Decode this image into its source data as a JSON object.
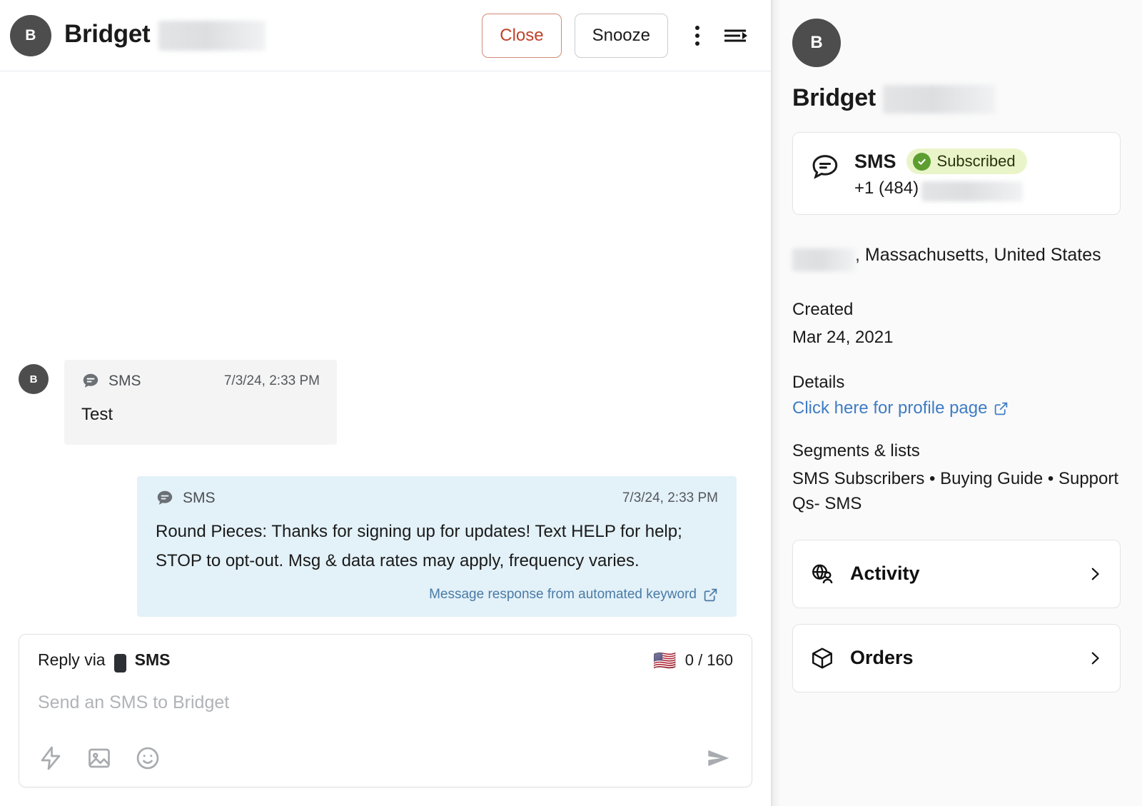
{
  "conversation": {
    "header": {
      "avatar_initial": "B",
      "contact_name": "Bridget",
      "close_label": "Close",
      "snooze_label": "Snooze",
      "more_icon": "kebab-menu-icon",
      "panel_icon": "collapse-panel-icon"
    },
    "messages": [
      {
        "direction": "inbound",
        "avatar_initial": "B",
        "channel": "SMS",
        "timestamp": "7/3/24, 2:33 PM",
        "text": "Test",
        "footer": null
      },
      {
        "direction": "outbound",
        "channel": "SMS",
        "timestamp": "7/3/24, 2:33 PM",
        "text": "Round Pieces: Thanks for signing up for updates! Text HELP for help; STOP to opt-out. Msg & data rates may apply, frequency varies.",
        "footer": "Message response from automated keyword"
      }
    ],
    "composer": {
      "reply_via_label": "Reply via",
      "channel": "SMS",
      "flag": "🇺🇸",
      "counter": "0 / 160",
      "placeholder": "Send an SMS to Bridget",
      "value": "",
      "tools": [
        "quick-reply-icon",
        "image-icon",
        "emoji-icon"
      ],
      "send_icon": "send-icon"
    }
  },
  "profile": {
    "avatar_initial": "B",
    "name": "Bridget",
    "channel_card": {
      "icon": "sms-bubble-icon",
      "title": "SMS",
      "status": "Subscribed",
      "phone": "+1 (484)"
    },
    "location": ", Massachusetts, United States",
    "created_label": "Created",
    "created_value": "Mar 24, 2021",
    "details_label": "Details",
    "details_link": "Click here for profile page",
    "segments_label": "Segments & lists",
    "segments_value": "SMS Subscribers • Buying Guide • Support Qs- SMS",
    "nav_items": [
      {
        "label": "Activity",
        "icon": "globe-person-icon"
      },
      {
        "label": "Orders",
        "icon": "box-icon"
      }
    ]
  },
  "colors": {
    "close_accent": "#c0422a",
    "outbound_bubble": "#e3f1f8",
    "inbound_bubble": "#f4f4f5",
    "link": "#3f7cc4",
    "badge_bg": "#e9f5c9",
    "badge_check": "#5d9e30",
    "avatar_bg": "#4d4d4d"
  }
}
